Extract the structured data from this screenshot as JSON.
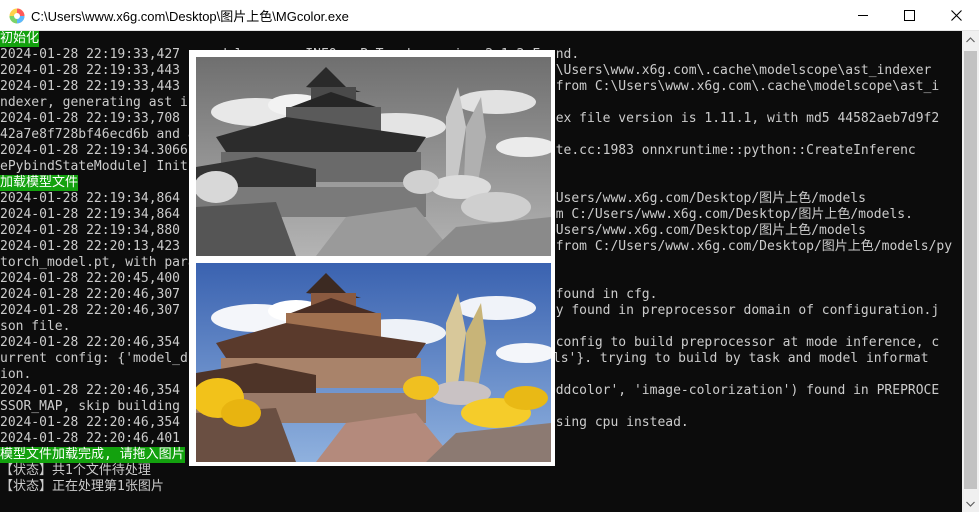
{
  "window": {
    "title": "C:\\Users\\www.x6g.com\\Desktop\\图片上色\\MGcolor.exe",
    "icon": "mgcolor-app-icon",
    "controls": [
      "minimize-icon",
      "maximize-icon",
      "close-icon"
    ]
  },
  "console": {
    "lines": [
      "初始化",
      "2024-01-28 22:19:33,427 - modelscope - INFO - PyTorch version 2.1.2 Found.",
      "2024-01-28 22:19:33,443 - modelscope - INFO - Loading ast index from C:\\Users\\www.x6g.com\\.cache\\modelscope\\ast_indexer",
      "2024-01-28 22:19:33,443 - modelscope - INFO - No valid ast index found from C:\\Users\\www.x6g.com\\.cache\\modelscope\\ast_i",
      "ndexer, generating ast index from prebuilt!",
      "2024-01-28 22:19:33,708 - modelscope - INFO - Loading done! Current index file version is 1.11.1, with md5 44582aeb7d9f2",
      "42a7e8f728bf46ecd6b and a total number of 953 components indexed",
      "2024-01-28 22:19:34.3066 [W:onnxruntime:Default, onnxruntime_pybind_state.cc:1983 onnxruntime::python::CreateInferenc",
      "ePybindStateModule] Init provider bridge failed.",
      "加载模型文件",
      "2024-01-28 22:19:34,864 - modelscope - INFO - initialize model from C:/Users/www.x6g.com/Desktop/图片上色/models",
      "2024-01-28 22:19:34,864 - modelscope - INFO - Loading DDColor model from C:/Users/www.x6g.com/Desktop/图片上色/models.",
      "2024-01-28 22:19:34,880 - modelscope - INFO - initialize model from C:/Users/www.x6g.com/Desktop/图片上色/models",
      "2024-01-28 22:20:13,423 - modelscope - INFO - Loading pretrained model from C:/Users/www.x6g.com/Desktop/图片上色/models/py",
      "torch_model.pt, with param key: [params].",
      "2024-01-28 22:20:45,400 - modelscope - INFO - load model done.",
      "2024-01-28 22:20:46,307 - modelscope - WARNING - No preprocessor field found in cfg.",
      "2024-01-28 22:20:46,307 - modelscope - WARNING - No val key and type key found in preprocessor domain of configuration.j",
      "son file.",
      "2024-01-28 22:20:46,354 - modelscope - WARNING - Cannot find available config to build preprocessor at mode inference, c",
      "urrent config: {'model_dir': 'C:/Users/www.x6g.com/Desktop/图片上色/models'}. trying to build by task and model informat",
      "ion.",
      "2024-01-28 22:20:46,354 - modelscope - WARNING - No preprocessor key ('ddcolor', 'image-colorization') found in PREPROCE",
      "SSOR_MAP, skip building preprocessor.",
      "2024-01-28 22:20:46,354 - modelscope - WARNING - Device cuda:0 is not using cpu instead.",
      "2024-01-28 22:20:46,401 - modelscope - INFO - cuda is not available",
      "模型文件加载完成, 请拖入图片",
      "【状态】共1个文件待处理",
      "【状态】正在处理第1张图片"
    ]
  },
  "preview": {
    "top_image": "grayscale-input-preview",
    "bottom_image": "colorized-output-preview",
    "colors": {
      "sky": "#4b74b8",
      "cloud": "#f4f6fa",
      "roof": "#5a3a2c",
      "wall": "#a9836a",
      "foliage": "#f2c21a",
      "stone": "#b0a6a6"
    }
  },
  "colors": {
    "console_bg": "#0c0c0c",
    "console_text": "#cccccc",
    "highlight_bg": "#13a10e",
    "highlight_text": "#ffffff"
  }
}
